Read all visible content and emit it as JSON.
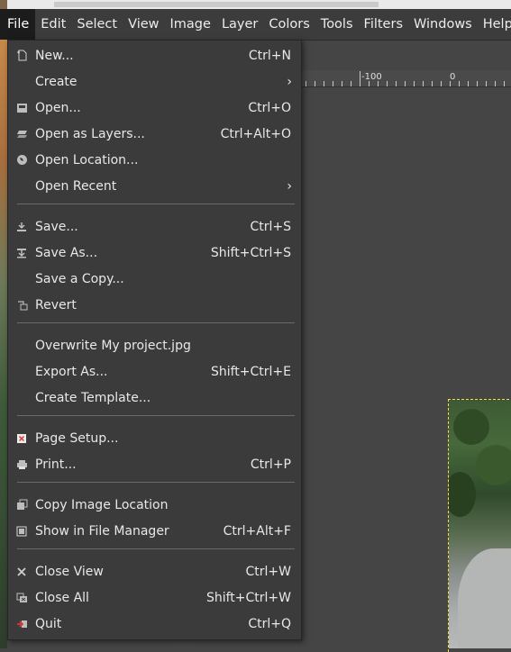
{
  "menubar": {
    "items": [
      "File",
      "Edit",
      "Select",
      "View",
      "Image",
      "Layer",
      "Colors",
      "Tools",
      "Filters",
      "Windows",
      "Help"
    ]
  },
  "ruler": {
    "labels": [
      "-100",
      "0"
    ]
  },
  "file_menu": {
    "items": [
      {
        "label": "New...",
        "shortcut": "Ctrl+N",
        "icon": "new-image-icon"
      },
      {
        "label": "Create",
        "submenu": true
      },
      {
        "label": "Open...",
        "shortcut": "Ctrl+O",
        "icon": "open-image-icon"
      },
      {
        "label": "Open as Layers...",
        "shortcut": "Ctrl+Alt+O",
        "icon": "open-as-layers-icon"
      },
      {
        "label": "Open Location...",
        "icon": "open-location-icon"
      },
      {
        "label": "Open Recent",
        "submenu": true
      },
      {
        "label": "Save...",
        "shortcut": "Ctrl+S",
        "icon": "save-icon"
      },
      {
        "label": "Save As...",
        "shortcut": "Shift+Ctrl+S",
        "icon": "save-as-icon"
      },
      {
        "label": "Save a Copy..."
      },
      {
        "label": "Revert",
        "icon": "revert-icon"
      },
      {
        "label": "Overwrite My project.jpg"
      },
      {
        "label": "Export As...",
        "shortcut": "Shift+Ctrl+E"
      },
      {
        "label": "Create Template..."
      },
      {
        "label": "Page Setup...",
        "icon": "page-setup-icon"
      },
      {
        "label": "Print...",
        "shortcut": "Ctrl+P",
        "icon": "print-icon"
      },
      {
        "label": "Copy Image Location",
        "icon": "copy-location-icon"
      },
      {
        "label": "Show in File Manager",
        "shortcut": "Ctrl+Alt+F",
        "icon": "file-manager-icon"
      },
      {
        "label": "Close View",
        "shortcut": "Ctrl+W",
        "icon": "close-view-icon"
      },
      {
        "label": "Close All",
        "shortcut": "Shift+Ctrl+W",
        "icon": "close-all-icon"
      },
      {
        "label": "Quit",
        "shortcut": "Ctrl+Q",
        "icon": "quit-icon"
      }
    ],
    "submenu_arrow": "›"
  },
  "colors": {
    "menu_bg": "#3b3b3b",
    "menubar_bg": "#3c3c3c",
    "canvas_bg": "#454545",
    "selection_dash": "#f0e14a",
    "text": "#e8e8e8"
  }
}
